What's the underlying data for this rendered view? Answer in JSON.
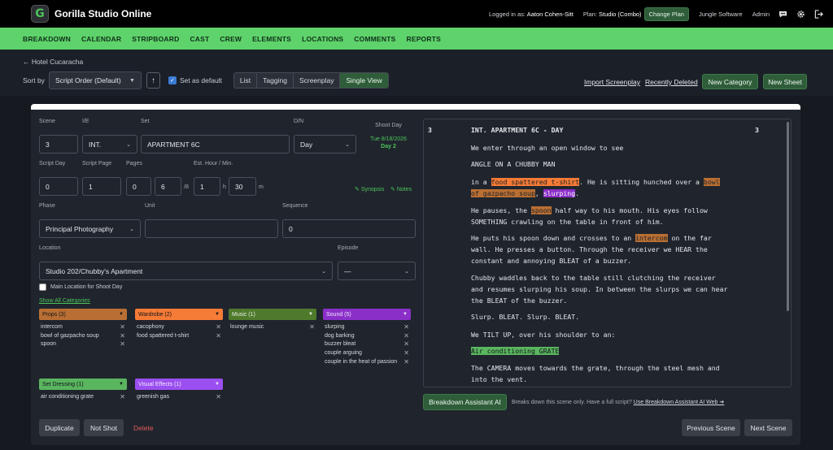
{
  "app": {
    "title": "Gorilla Studio Online",
    "logo_letter": "G"
  },
  "topbar": {
    "logged_in_label": "Logged in as:",
    "user": "Aaton Cohen-Sitt",
    "plan_label": "Plan:",
    "plan": "Studio (Combo)",
    "change_plan": "Change Plan",
    "company": "Jungle Software",
    "admin": "Admin"
  },
  "nav": [
    "BREAKDOWN",
    "CALENDAR",
    "STRIPBOARD",
    "CAST",
    "CREW",
    "ELEMENTS",
    "LOCATIONS",
    "COMMENTS",
    "REPORTS"
  ],
  "breadcrumb": "← Hotel Cucaracha",
  "toolbar": {
    "sort_by": "Sort by",
    "sort_value": "Script Order (Default)",
    "set_default": "Set as default",
    "views": [
      "List",
      "Tagging",
      "Screenplay",
      "Single View"
    ],
    "import": "Import Screenplay",
    "recently_deleted": "Recently Deleted",
    "new_category": "New Category",
    "new_sheet": "New Sheet"
  },
  "form": {
    "scene_label": "Scene",
    "scene": "3",
    "ie_label": "I/E",
    "ie": "INT.",
    "set_label": "Set",
    "set": "APARTMENT 6C",
    "dn_label": "D/N",
    "dn": "Day",
    "shoot_day_label": "Shoot Day",
    "shoot_date": "Tue 8/18/2026",
    "shoot_day": "Day 2",
    "script_day_label": "Script Day",
    "script_day": "0",
    "script_page_label": "Script Page",
    "script_page": "1",
    "pages_label": "Pages",
    "pages_whole": "0",
    "pages_eighths": "6",
    "pages_unit": "/8",
    "est_label": "Est. Hour / Min.",
    "est_hour": "1",
    "hour_unit": "h",
    "est_min": "30",
    "min_unit": "m",
    "synopsis": "Synopsis",
    "notes": "Notes",
    "phase_label": "Phase",
    "phase": "Principal Photography",
    "unit_label": "Unit",
    "unit": "",
    "sequence_label": "Sequence",
    "sequence": "0",
    "location_label": "Location",
    "location": "Studio 202/Chubby's Apartment",
    "episode_label": "Episode",
    "episode": "—",
    "main_location": "Main Location for Shoot Day",
    "show_all": "Show All Categories"
  },
  "categories": [
    {
      "name": "Props (3)",
      "color": "#b96f33",
      "items": [
        "intercom",
        "bowl of gazpacho soup",
        "spoon"
      ]
    },
    {
      "name": "Wardrobe (2)",
      "color": "#f57b36",
      "items": [
        "cacophony",
        "food spattered t-shirt"
      ]
    },
    {
      "name": "Music (1)",
      "color": "#4f7a2c",
      "items": [
        "lounge music"
      ]
    },
    {
      "name": "Sound (5)",
      "color": "#8b2fc9",
      "items": [
        "slurping",
        "dog barking",
        "buzzer bleat",
        "couple arguing",
        "couple in the heat of passion"
      ]
    },
    {
      "name": "Set Dressing (1)",
      "color": "#5ab55f",
      "items": [
        "air conditioning grate"
      ]
    },
    {
      "name": "Visual Effects (1)",
      "color": "#9b4ff0",
      "items": [
        "greenish gas"
      ]
    }
  ],
  "script": {
    "scene_num": "3",
    "heading": "INT. APARTMENT 6C - DAY",
    "p1": "We enter through an open window to see",
    "p2": "ANGLE ON A CHUBBY MAN",
    "p3a": "in a ",
    "p3b": "food spattered t-shirt",
    "p3c": ". He is sitting hunched over a ",
    "p3d": "bowl",
    "p3e": "of gazpacho soup",
    "p3f": ", ",
    "p3g": "slurping",
    "p3h": ".",
    "p4a": "He pauses, the ",
    "p4b": "spoon",
    "p4c": " half way to his mouth. His eyes follow",
    "p4d": "SOMETHING crawling on the table in front of him.",
    "p5a": "He puts his spoon down and crosses to an ",
    "p5b": "intercom",
    "p5c": " on the far",
    "p5d": "wall. He presses a button. Through the receiver we HEAR the",
    "p5e": "constant and annoying BLEAT of a buzzer.",
    "p6a": "Chubby waddles back to the table still clutching the receiver",
    "p6b": "and resumes slurping his soup. In between the slurps we can hear",
    "p6c": "the BLEAT of the buzzer.",
    "p7": "Slurp. BLEAT. Slurp. BLEAT.",
    "p8": "We TILT UP, over his shoulder to an:",
    "p9": "Air conditioning GRATE",
    "p10a": "The CAMERA moves towards the grate, through the steel mesh and",
    "p10b": "into the vent."
  },
  "assistant": {
    "button": "Breakdown Assistant AI",
    "note": "Breaks down this scene only. Have a full script?",
    "link": "Use Breakdown Assistant AI Web ➔"
  },
  "footer": {
    "duplicate": "Duplicate",
    "not_shot": "Not Shot",
    "delete": "Delete",
    "previous": "Previous Scene",
    "next": "Next Scene"
  }
}
